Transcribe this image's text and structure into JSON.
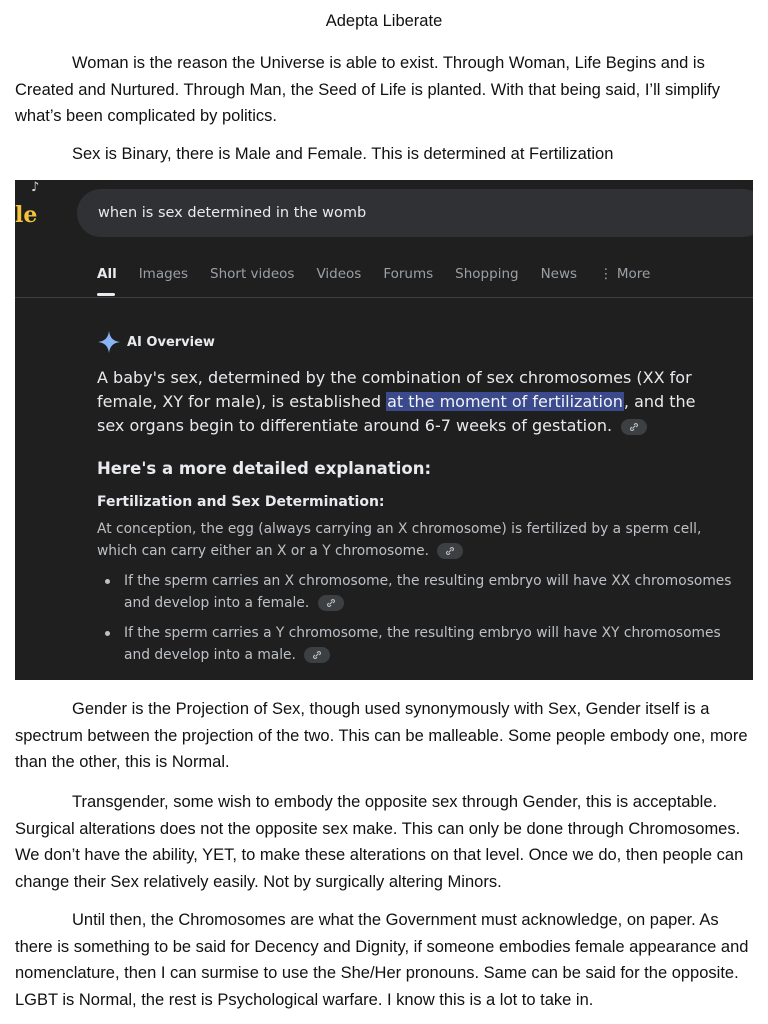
{
  "document": {
    "title": "Adepta Liberate",
    "paragraphs": [
      "Woman is the reason the Universe is able to exist. Through Woman, Life Begins and is Created and Nurtured. Through Man, the Seed of Life is planted. With that being said, I’ll simplify what’s been complicated by politics.",
      "Sex is Binary, there is Male and Female. This is determined at Fertilization",
      "Gender is the Projection of Sex, though used synonymously with Sex, Gender itself is a spectrum between the projection of the two. This can be malleable. Some people embody one, more than the other, this is Normal.",
      "Transgender, some wish to embody the opposite sex through Gender, this is acceptable. Surgical alterations does not the opposite sex make. This can only be done through Chromosomes. We don’t have the ability, YET, to make these alterations on that level. Once we do, then people can change their Sex relatively easily. Not by surgically altering Minors.",
      "Until then, the Chromosomes are what the Government must acknowledge, on paper. As there is something to be said for Decency and Dignity, if someone embodies female appearance and nomenclature, then I can surmise to use the She/Her pronouns. Same can be said for the opposite. LGBT is Normal, the rest is Psychological warfare. I know this is a lot to take in."
    ]
  },
  "screenshot": {
    "logo_letter": "le",
    "search_query": "when is sex determined in the womb",
    "tabs": [
      "All",
      "Images",
      "Short videos",
      "Videos",
      "Forums",
      "Shopping",
      "News",
      "⋮ More"
    ],
    "active_tab": "All",
    "ai_overview_label": "AI Overview",
    "summary_before": "A baby's sex, determined by the combination of sex chromosomes (XX for female, XY for male), is established ",
    "summary_highlight": "at the moment of fertilization",
    "summary_after": ", and the sex organs begin to differentiate around 6-7 weeks of gestation.",
    "detail_heading": "Here's a more detailed explanation:",
    "section_title": "Fertilization and Sex Determination:",
    "section_text": "At conception, the egg (always carrying an X chromosome) is fertilized by a sperm cell, which can carry either an X or a Y chromosome.",
    "bullets": [
      "If the sperm carries an X chromosome, the resulting embryo will have XX chromosomes and develop into a female.",
      "If the sperm carries a Y chromosome, the resulting embryo will have XY chromosomes and develop into a male."
    ],
    "colors": {
      "background": "#1f1f1f",
      "search_bg": "#303134",
      "highlight": "#3b4a8c",
      "spark_blue": "#8ab4f8"
    }
  }
}
